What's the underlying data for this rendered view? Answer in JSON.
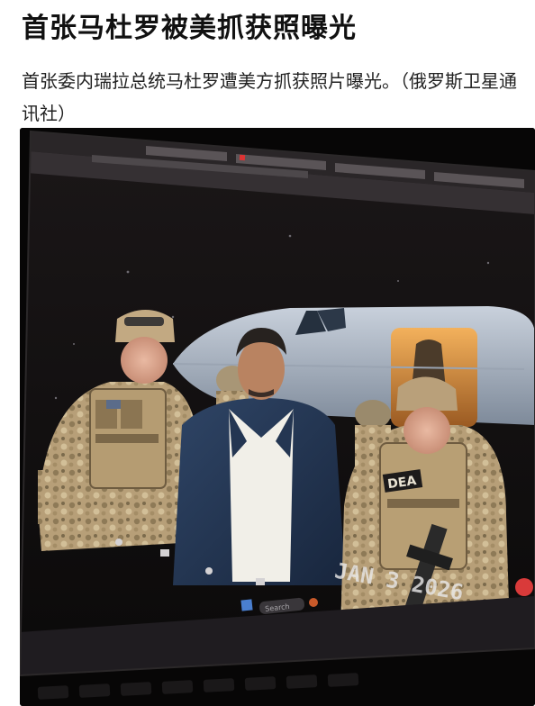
{
  "article": {
    "title": "首张马杜罗被美抓获照曝光",
    "summary": "首张委内瑞拉总统马杜罗遭美方抓获照片曝光。（俄罗斯卫星通讯社）"
  },
  "photo": {
    "date_stamp": "JAN 3 2026",
    "vest_patch": "DEA",
    "taskbar_search": "Search"
  }
}
